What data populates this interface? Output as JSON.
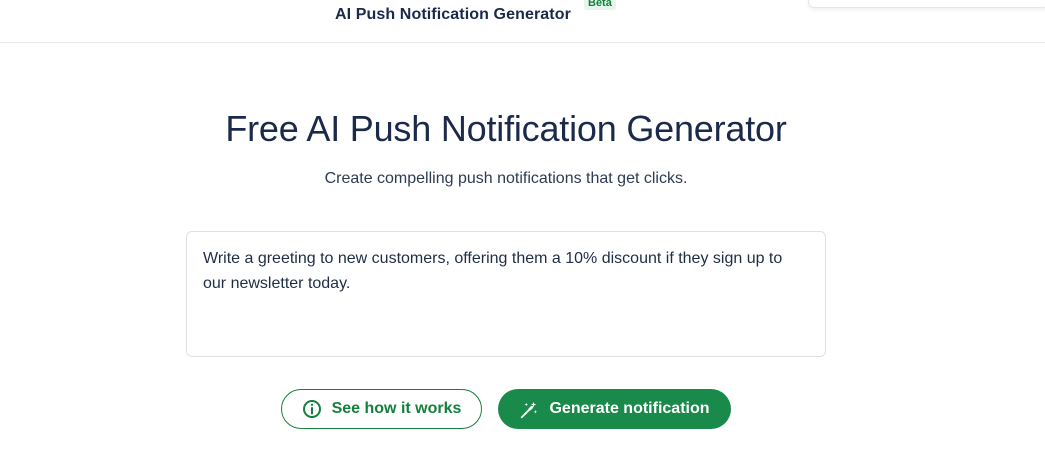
{
  "header": {
    "title": "AI Push Notification Generator",
    "badge": "Beta"
  },
  "hero": {
    "title": "Free AI Push Notification Generator",
    "subtitle": "Create compelling push notifications that get clicks."
  },
  "prompt": {
    "value": "Write a greeting to new customers, offering them a 10% discount if they sign up to our newsletter today."
  },
  "actions": {
    "how_it_works_label": "See how it works",
    "how_it_works_icon": "info-circle-icon",
    "generate_label": "Generate notification",
    "generate_icon": "magic-wand-icon"
  },
  "colors": {
    "brand_green": "#1a8a4a",
    "text_navy": "#1b2a4a"
  }
}
